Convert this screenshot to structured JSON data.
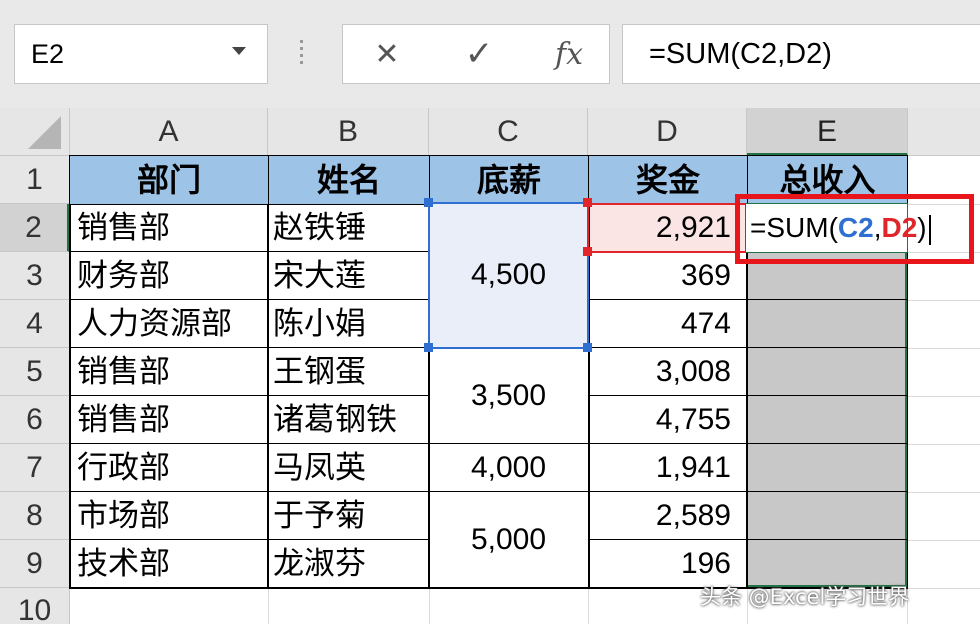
{
  "name_box": {
    "value": "E2"
  },
  "formula_bar": {
    "cancel_label": "✕",
    "enter_label": "✓",
    "fx_label": "fx",
    "formula": "=SUM(C2,D2)"
  },
  "columns": [
    "A",
    "B",
    "C",
    "D",
    "E"
  ],
  "rows": [
    "1",
    "2",
    "3",
    "4",
    "5",
    "6",
    "7",
    "8",
    "9",
    "10"
  ],
  "table": {
    "headers": [
      "部门",
      "姓名",
      "底薪",
      "奖金",
      "总收入"
    ],
    "departments": [
      "销售部",
      "财务部",
      "人力资源部",
      "销售部",
      "销售部",
      "行政部",
      "市场部",
      "技术部"
    ],
    "names": [
      "赵铁锤",
      "宋大莲",
      "陈小娟",
      "王钢蛋",
      "诸葛钢铁",
      "马凤英",
      "于予菊",
      "龙淑芬"
    ],
    "base_salary_groups": [
      "4,500",
      "3,500",
      "4,000",
      "5,000"
    ],
    "bonuses": [
      "2,921",
      "369",
      "474",
      "3,008",
      "4,755",
      "1,941",
      "2,589",
      "196"
    ]
  },
  "edit_cell": {
    "prefix": "=SUM(",
    "ref1": "C2",
    "sep": ",",
    "ref2": "D2",
    "suffix": ")"
  },
  "watermark": "头条 @Excel学习世界",
  "colors": {
    "header_fill": "#9dc3e6",
    "selected_fill": "#c8c8c8",
    "ref_blue": "#2e6fd1",
    "ref_red": "#e0262b",
    "excel_green": "#217346"
  }
}
